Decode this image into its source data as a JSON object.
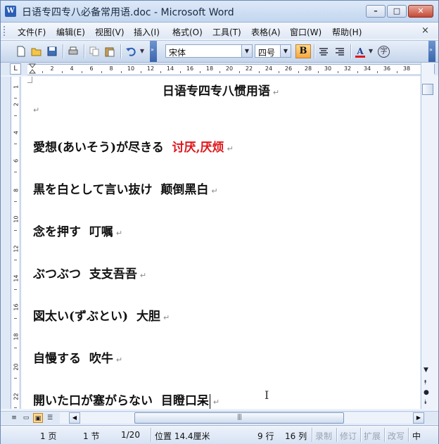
{
  "window": {
    "title": "日语专四专八必备常用语.doc - Microsoft Word",
    "app_icon_letter": "W",
    "controls": {
      "minimize": "–",
      "maximize": "□",
      "close": "✕"
    }
  },
  "menu": {
    "items": [
      "文件(F)",
      "编辑(E)",
      "视图(V)",
      "插入(I)",
      "格式(O)",
      "工具(T)",
      "表格(A)",
      "窗口(W)",
      "帮助(H)"
    ],
    "close_doc": "×"
  },
  "toolbar": {
    "font_name": "宋体",
    "font_size": "四号",
    "bold": "B",
    "font_color_letter": "A",
    "phonetic_glyph": "字",
    "accent_color": "#f5a742",
    "font_color_bar": "#e0161b"
  },
  "ruler": {
    "tab_selector": "L",
    "h_numbers": [
      "2",
      "4",
      "6",
      "8",
      "10",
      "12",
      "14",
      "16",
      "18",
      "20",
      "22",
      "24",
      "26",
      "28",
      "30",
      "32",
      "34",
      "36",
      "38"
    ],
    "v_numbers": [
      "1",
      "2",
      "4",
      "6",
      "8",
      "10",
      "12",
      "14",
      "16",
      "18",
      "20",
      "22"
    ]
  },
  "document": {
    "title": "日语专四专八惯用语",
    "paragraph_mark": "↵",
    "entries": [
      {
        "jp": "愛想(あいそう)が尽きる",
        "cn": "讨厌,厌烦",
        "cn_red": true
      },
      {
        "jp": "黒を白として言い抜け",
        "cn": "颠倒黑白",
        "cn_red": false
      },
      {
        "jp": "念を押す",
        "cn": "叮嘱",
        "cn_red": false
      },
      {
        "jp": "ぶつぶつ",
        "cn": "支支吾吾",
        "cn_red": false
      },
      {
        "jp": "図太い(ずぶとい)",
        "cn": "大胆",
        "cn_red": false
      },
      {
        "jp": "自慢する",
        "cn": "吹牛",
        "cn_red": false
      },
      {
        "jp": "開いた口が塞がらない",
        "cn": "目瞪口呆",
        "cn_red": false
      }
    ],
    "ibeam": "I"
  },
  "status": {
    "page": "1 页",
    "section": "1 节",
    "page_of": "1/20",
    "position": "位置 14.4厘米",
    "line": "9 行",
    "column": "16 列",
    "rec": "录制",
    "trk": "修订",
    "ext": "扩展",
    "ovr": "改写",
    "lang": "中"
  }
}
